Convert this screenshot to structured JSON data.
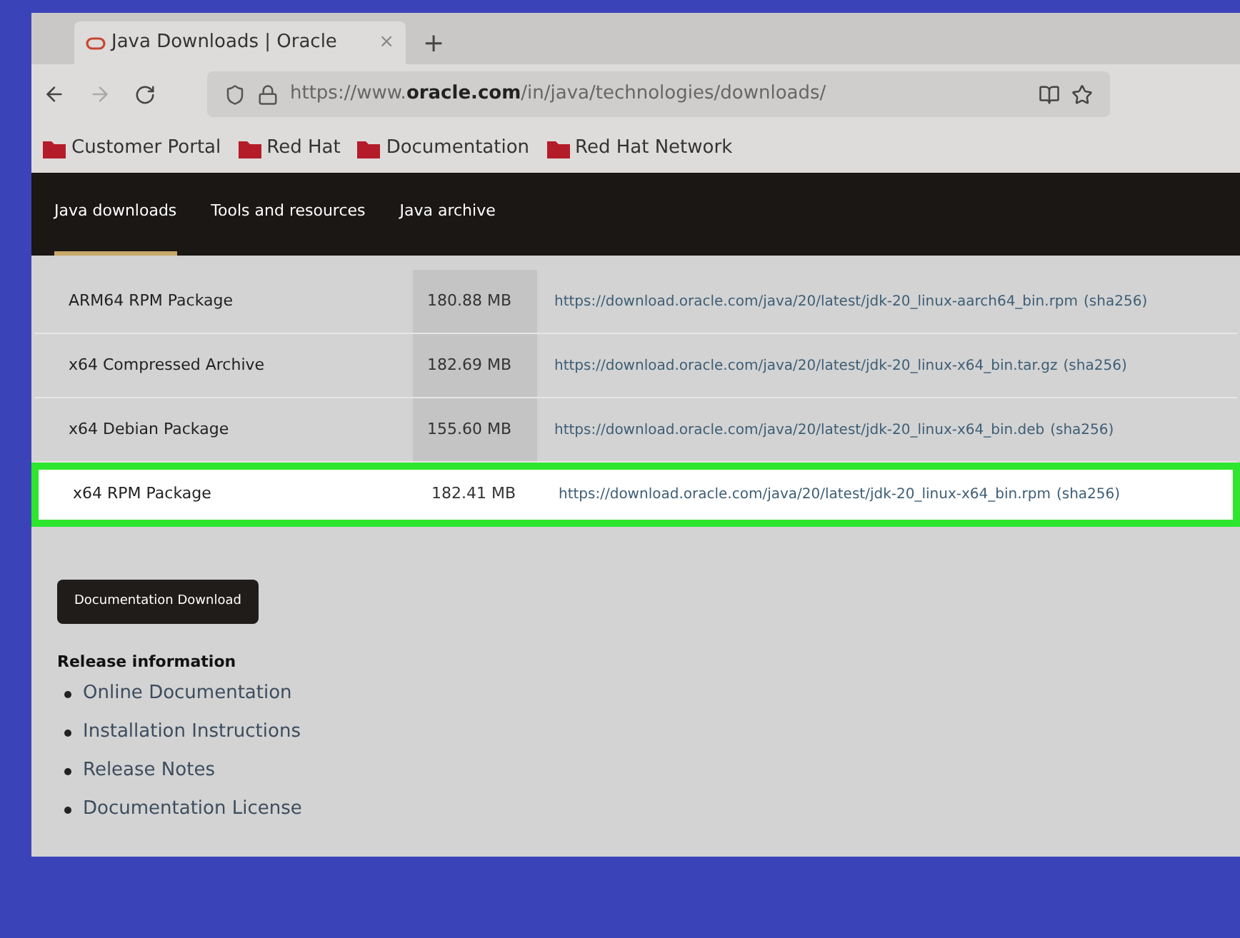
{
  "browser": {
    "tab": {
      "title": "Java Downloads | Oracle",
      "close": "×"
    },
    "new_tab": "+",
    "url": "https://www.**oracle.com**/in/java/technologies/downloads/",
    "bookmarks": [
      "Customer Portal",
      "Red Hat",
      "Documentation",
      "Red Hat Network"
    ]
  },
  "nav": [
    {
      "label": "Java downloads",
      "selected": true
    },
    {
      "label": "Tools and resources",
      "selected": false
    },
    {
      "label": "Java archive",
      "selected": false
    }
  ],
  "table": {
    "rows": [
      {
        "name": "ARM64 RPM Package",
        "size": "180.88 MB",
        "link": "https://download.oracle.com/java/20/latest/jdk-20_linux-aarch64_bin.rpm",
        "checksum": "(sha256)",
        "highlighted": false
      },
      {
        "name": "x64 Compressed Archive",
        "size": "182.69 MB",
        "link": "https://download.oracle.com/java/20/latest/jdk-20_linux-x64_bin.tar.gz",
        "checksum": "(sha256)",
        "highlighted": false
      },
      {
        "name": "x64 Debian Package",
        "size": "155.60 MB",
        "link": "https://download.oracle.com/java/20/latest/jdk-20_linux-x64_bin.deb",
        "checksum": "(sha256)",
        "highlighted": false
      },
      {
        "name": "x64 RPM Package",
        "size": "182.41 MB",
        "link": "https://download.oracle.com/java/20/latest/jdk-20_linux-x64_bin.rpm",
        "checksum": "(sha256)",
        "highlighted": true
      }
    ]
  },
  "doc_button": "Documentation Download",
  "release": {
    "title": "Release information",
    "links": [
      "Online Documentation",
      "Installation Instructions",
      "Release Notes",
      "Documentation License"
    ]
  }
}
